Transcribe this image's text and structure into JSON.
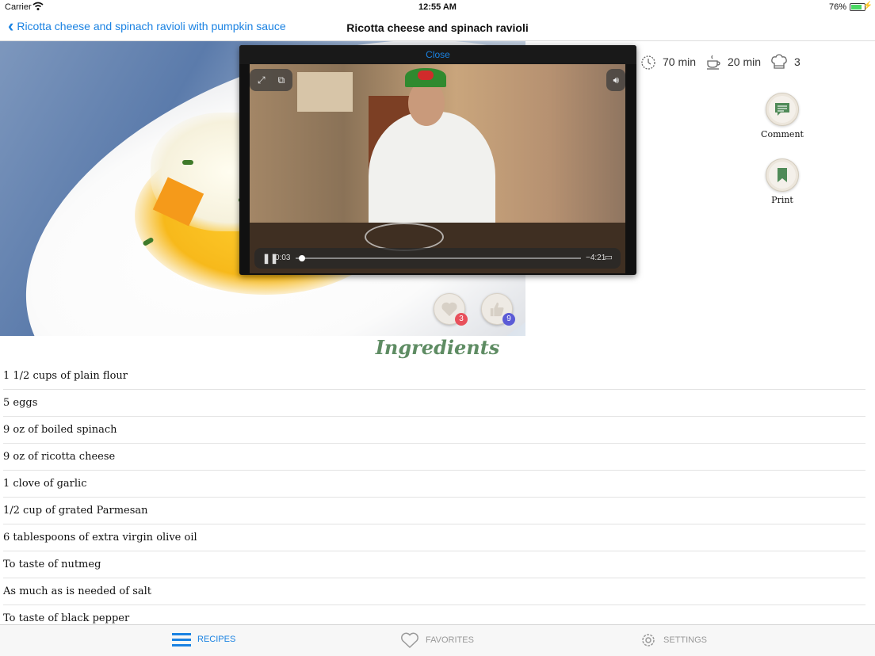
{
  "status_bar": {
    "carrier": "Carrier",
    "time": "12:55 AM",
    "battery": "76%"
  },
  "nav": {
    "back_label": "Ricotta cheese and spinach ravioli with pumpkin sauce",
    "title": "Ricotta cheese and spinach ravioli"
  },
  "meta": {
    "total_time": "70 min",
    "prep_time": "20 min",
    "difficulty": "3"
  },
  "actions": {
    "comment": "Comment",
    "print": "Print"
  },
  "hero": {
    "favorites_count": "3",
    "likes_count": "9"
  },
  "player": {
    "close": "Close",
    "elapsed": "0:03",
    "remaining": "−4:21",
    "progress": 0.012
  },
  "ingredients": {
    "title": "Ingredients",
    "items": [
      "1 1/2 cups of plain flour",
      "5 eggs",
      "9 oz of boiled spinach",
      "9 oz of ricotta cheese",
      "1 clove of garlic",
      "1/2 cup of grated Parmesan",
      "6 tablespoons of extra virgin olive oil",
      "To taste of nutmeg",
      "As much as  is needed of salt",
      "To taste of black pepper"
    ]
  },
  "tabs": {
    "recipes": "RECIPES",
    "favorites": "FAVORITES",
    "settings": "SETTINGS"
  },
  "colors": {
    "accent": "#1a82e2",
    "title_green": "#5e8c63",
    "fav_badge": "#e8505b",
    "like_badge": "#5b5bd6"
  }
}
